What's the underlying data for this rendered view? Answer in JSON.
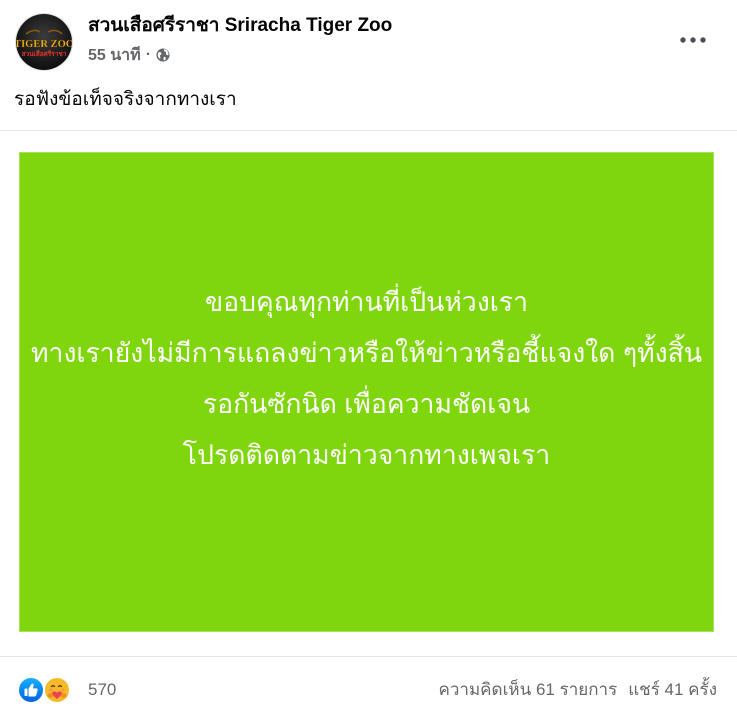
{
  "post": {
    "avatar": {
      "logo_top": "TIGER ZOO",
      "logo_bottom": "สวนเสือศรีราชา"
    },
    "page_name": "สวนเสือศรีราชา Sriracha Tiger Zoo",
    "timestamp": "55 นาที",
    "separator": "·",
    "privacy_icon": "globe-icon",
    "more_icon": "more-options-icon",
    "text": "รอฟังข้อเท็จจริงจากทางเรา"
  },
  "image": {
    "lines": [
      "ขอบคุณทุกท่านที่เป็นห่วงเรา",
      "ทางเรายังไม่มีการแถลงข่าวหรือให้ข่าวหรือชี้แจงใด ๆทั้งสิ้น",
      "รอกันซักนิด เพื่อความชัดเจน",
      "โปรดติดตามข่าวจากทางเพจเรา"
    ]
  },
  "footer": {
    "reaction_icons": [
      "like-icon",
      "care-icon"
    ],
    "reaction_count": "570",
    "comments": "ความคิดเห็น 61 รายการ",
    "shares": "แชร์ 41 ครั้ง"
  },
  "colors": {
    "image_background": "#7fd60d",
    "image_text": "#ffffff",
    "primary_text": "#050505",
    "secondary_text": "#65676b",
    "like": "#1877f2",
    "care": "#f7b928"
  }
}
